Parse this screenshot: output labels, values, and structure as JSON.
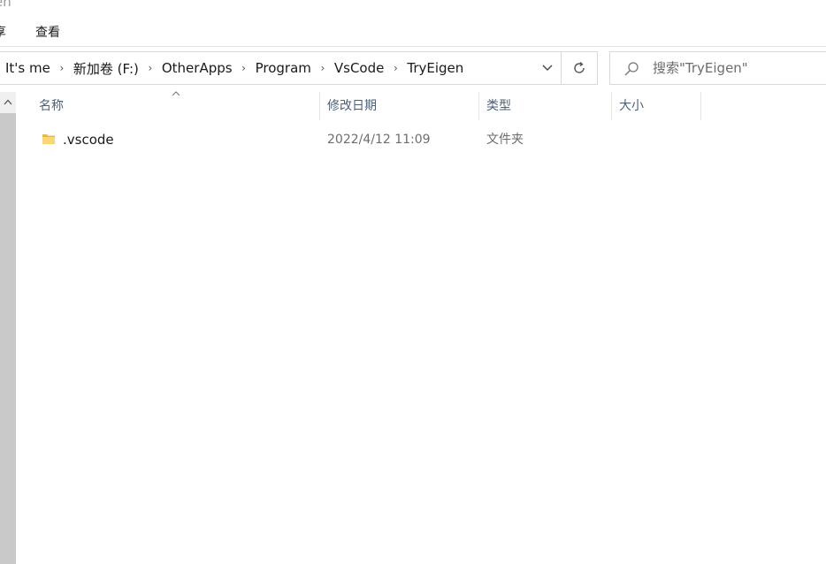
{
  "window": {
    "title_fragment": "en"
  },
  "ribbon": {
    "tab_clipped": "享",
    "tab_view": "查看"
  },
  "address_bar": {
    "crumbs": [
      "It's me",
      "新加卷 (F:)",
      "OtherApps",
      "Program",
      "VsCode",
      "TryEigen"
    ]
  },
  "search": {
    "placeholder": "搜索\"TryEigen\""
  },
  "columns": {
    "name": "名称",
    "date_modified": "修改日期",
    "type": "类型",
    "size": "大小"
  },
  "files": [
    {
      "name": ".vscode",
      "date_modified": "2022/4/12 11:09",
      "type": "文件夹",
      "size": ""
    }
  ],
  "colors": {
    "header_text": "#4c607a",
    "folder_yellow": "#f8d775",
    "border": "#d9d9d9"
  }
}
